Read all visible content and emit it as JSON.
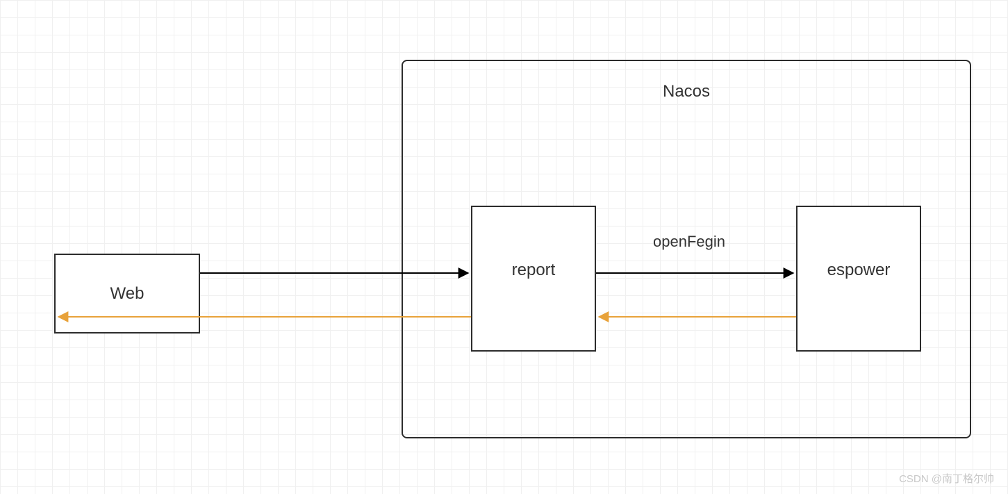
{
  "nodes": {
    "web": {
      "label": "Web"
    },
    "report": {
      "label": "report"
    },
    "espower": {
      "label": "espower"
    }
  },
  "container": {
    "title": "Nacos"
  },
  "edges": {
    "web_to_report": {
      "label": ""
    },
    "report_to_espower": {
      "label": "openFegin"
    },
    "report_to_web_return": {
      "label": ""
    },
    "espower_to_report_return": {
      "label": ""
    }
  },
  "colors": {
    "forward_arrow": "#000000",
    "return_arrow": "#e8a23a",
    "border": "#2c2c2c"
  },
  "watermark": "CSDN @南丁格尔帅"
}
